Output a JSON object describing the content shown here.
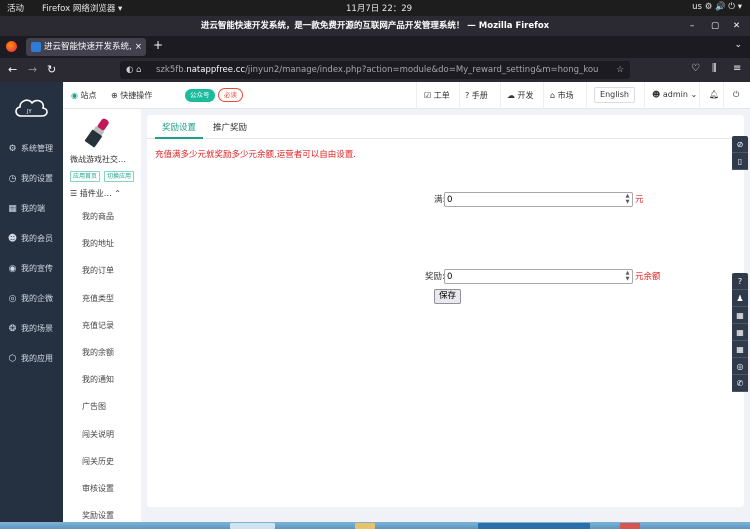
{
  "gnome": {
    "activities": "活动",
    "app": "Firefox 网络浏览器 ▾",
    "clock": "11月7日  22：29",
    "sys": "us  ⚙  🔊  ⏻ ▾"
  },
  "window": {
    "title": "进云智能快速开发系统，是一款免费开源的互联网产品开发管理系统！ — Mozilla Firefox"
  },
  "tabs": [
    {
      "label": "进云智能快速开发系统,",
      "close": "×"
    }
  ],
  "newtab": "+",
  "navbar": {
    "url_host_muted": "szk5fb.",
    "url_host": "natappfree.cc",
    "url_path": "/jinyun2/manage/index.php?action=module&do=My_reward_setting&m=hong_kou"
  },
  "sidebar": {
    "items": [
      {
        "icon": "gear-icon",
        "glyph": "⚙",
        "label": "系统管理"
      },
      {
        "icon": "dashboard-icon",
        "glyph": "◷",
        "label": "我的设置"
      },
      {
        "icon": "grid-icon",
        "glyph": "▦",
        "label": "我的端"
      },
      {
        "icon": "user-icon",
        "glyph": "☻",
        "label": "我的会员"
      },
      {
        "icon": "promote-icon",
        "glyph": "◉",
        "label": "我的宣传"
      },
      {
        "icon": "wechat-work-icon",
        "glyph": "◎",
        "label": "我的企微"
      },
      {
        "icon": "scene-icon",
        "glyph": "❂",
        "label": "我的场景"
      },
      {
        "icon": "cube-icon",
        "glyph": "⬡",
        "label": "我的应用"
      }
    ]
  },
  "topnav": {
    "site": "站点",
    "quick": "快捷操作",
    "official": "公众号",
    "must_read": "必读",
    "workorder": "工单",
    "manual": "手册",
    "develop": "开发",
    "market": "市场",
    "language": "English",
    "user": "admin"
  },
  "leftpanel": {
    "plugin_name": "微战游戏社交…",
    "btn_home": "应用首页",
    "btn_switch": "切换应用",
    "menu_head": "插件业…",
    "menu": [
      "我的商品",
      "我的地址",
      "我的订单",
      "充值类型",
      "充值记录",
      "我的余额",
      "我的通知",
      "广告图",
      "闯关说明",
      "闯关历史",
      "审核设置",
      "奖励设置"
    ]
  },
  "main": {
    "tabs": [
      "奖励设置",
      "推广奖励"
    ],
    "notice": "充值满多少元就奖励多少元余额,运营者可以自由设置.",
    "fields": [
      {
        "label": "满:",
        "value": "0",
        "unit": "元"
      },
      {
        "label": "奖励:",
        "value": "0",
        "unit": "元余额"
      }
    ],
    "save": "保存"
  }
}
